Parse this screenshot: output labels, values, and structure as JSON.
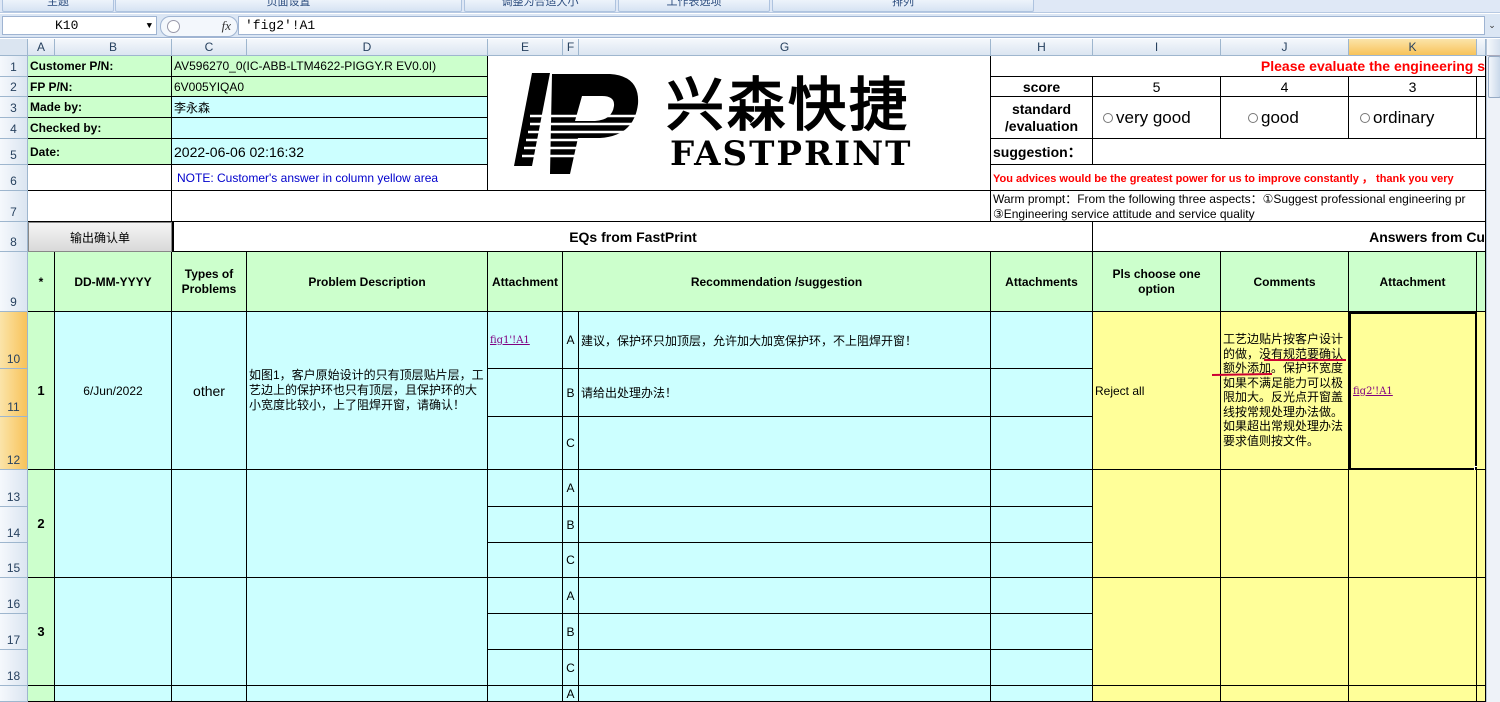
{
  "ribbon": {
    "buttons": [
      "主题",
      "页面设置",
      "调整为合适大小",
      "工作表选项",
      "排列"
    ]
  },
  "formula_bar": {
    "name_box": "K10",
    "fx_label": "fx",
    "content": "'fig2'!A1"
  },
  "columns": [
    "A",
    "B",
    "C",
    "D",
    "E",
    "F",
    "G",
    "H",
    "I",
    "J",
    "K"
  ],
  "rows": [
    "1",
    "2",
    "3",
    "4",
    "5",
    "6",
    "7",
    "8",
    "9",
    "10",
    "11",
    "12",
    "13",
    "14",
    "15",
    "16",
    "17",
    "18"
  ],
  "header_info": {
    "customer_pn_label": "Customer P/N:",
    "customer_pn_value": "AV596270_0(IC-ABB-LTM4622-PIGGY.R EV0.0I)",
    "fp_pn_label": "FP P/N:",
    "fp_pn_value": "6V005YIQA0",
    "made_by_label": "Made by:",
    "made_by_value": "李永森",
    "checked_by_label": "Checked by:",
    "checked_by_value": "",
    "date_label": "Date:",
    "date_value": "2022-06-06 02:16:32",
    "note": "NOTE: Customer's  answer in column yellow area"
  },
  "logo": {
    "chinese": "兴森快捷",
    "english": "FASTPRINT"
  },
  "evaluation": {
    "title": "Please evaluate the engineering s",
    "score_label": "score",
    "scores": [
      "5",
      "4",
      "3"
    ],
    "standard_label_1": "standard",
    "standard_label_2": "/evaluation",
    "options": [
      "very good",
      "good",
      "ordinary"
    ],
    "suggestion_label": "suggestion：",
    "advice": "You advices would be the greatest power for us to improve constantly ，  thank you very",
    "warm_prompt_1": "Warm prompt：From the following three aspects：①Suggest professional engineering pr",
    "warm_prompt_2": "③Engineering service attitude and service quality"
  },
  "section": {
    "output_button": "输出确认单",
    "eqs_title": "EQs from FastPrint",
    "answers_title": "Answers from Cu"
  },
  "table_headers": {
    "star": "*",
    "date": "DD-MM-YYYY",
    "types": "Types of Problems",
    "problem": "Problem Description",
    "attachment": "Attachment",
    "recommendation": "Recommendation /suggestion",
    "attachments": "Attachments",
    "choose": "Pls choose one option",
    "comments": "Comments",
    "answer_attachment": "Attachment"
  },
  "eq_rows": [
    {
      "no": "1",
      "date": "6/Jun/2022",
      "type": "other",
      "problem": "如图1，客户原始设计的只有顶层贴片层，工艺边上的保护环也只有顶层，且保护环的大小宽度比较小，上了阻焊开窗，请确认！",
      "attachment": "fig1'!A1",
      "options": [
        {
          "letter": "A",
          "text": "建议，保护环只加顶层，允许加大加宽保护环，不上阻焊开窗！"
        },
        {
          "letter": "B",
          "text": "请给出处理办法！"
        },
        {
          "letter": "C",
          "text": ""
        }
      ],
      "choice": "Reject all",
      "comment": "工艺边贴片按客户设计的做，没有规范要确认额外添加。保护环宽度如果不满足能力可以极限加大。反光点开窗盖线按常规处理办法做。如果超出常规处理办法要求值则按文件。",
      "answer_attachment": "fig2'!A1"
    },
    {
      "no": "2",
      "options": [
        {
          "letter": "A"
        },
        {
          "letter": "B"
        },
        {
          "letter": "C"
        }
      ]
    },
    {
      "no": "3",
      "options": [
        {
          "letter": "A"
        },
        {
          "letter": "B"
        },
        {
          "letter": "C"
        }
      ]
    },
    {
      "options": [
        {
          "letter": "A"
        }
      ]
    }
  ],
  "colors": {
    "green": "#ccffcc",
    "cyan": "#ccffff",
    "yellow": "#ffff99",
    "red_text": "#ff0000",
    "link": "#800080"
  }
}
